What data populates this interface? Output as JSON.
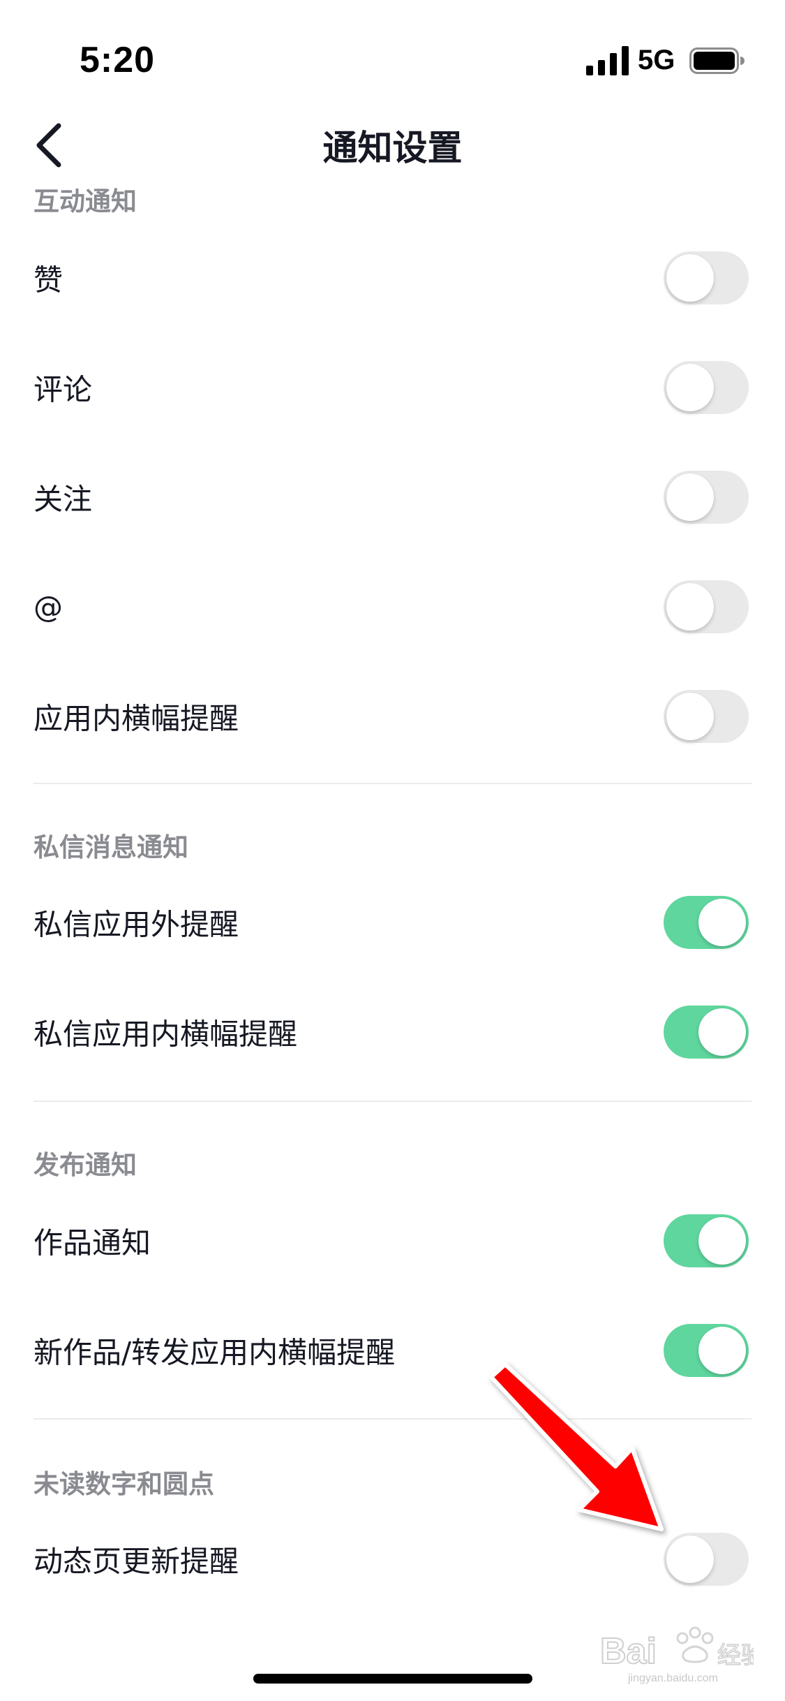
{
  "status_bar": {
    "time": "5:20",
    "network": "5G",
    "signal_icon": "cellular-signal-icon",
    "battery_icon": "battery-icon"
  },
  "nav": {
    "title": "通知设置",
    "back_icon": "chevron-left-icon"
  },
  "sections": [
    {
      "header": "互动通知",
      "items": [
        {
          "label": "赞",
          "on": false
        },
        {
          "label": "评论",
          "on": false
        },
        {
          "label": "关注",
          "on": false
        },
        {
          "label": "@",
          "on": false
        },
        {
          "label": "应用内横幅提醒",
          "on": false
        }
      ]
    },
    {
      "header": "私信消息通知",
      "items": [
        {
          "label": "私信应用外提醒",
          "on": true
        },
        {
          "label": "私信应用内横幅提醒",
          "on": true
        }
      ]
    },
    {
      "header": "发布通知",
      "items": [
        {
          "label": "作品通知",
          "on": true
        },
        {
          "label": "新作品/转发应用内横幅提醒",
          "on": true
        }
      ]
    },
    {
      "header": "未读数字和圆点",
      "items": [
        {
          "label": "动态页更新提醒",
          "on": false
        }
      ]
    }
  ],
  "colors": {
    "toggle_on": "#5fd69e",
    "toggle_off": "#e9e9ea",
    "annotation_arrow": "#ff0000",
    "section_header": "#8a8b91"
  },
  "watermark": {
    "logo": "Baidu经验",
    "url": "jingyan.baidu.com"
  }
}
